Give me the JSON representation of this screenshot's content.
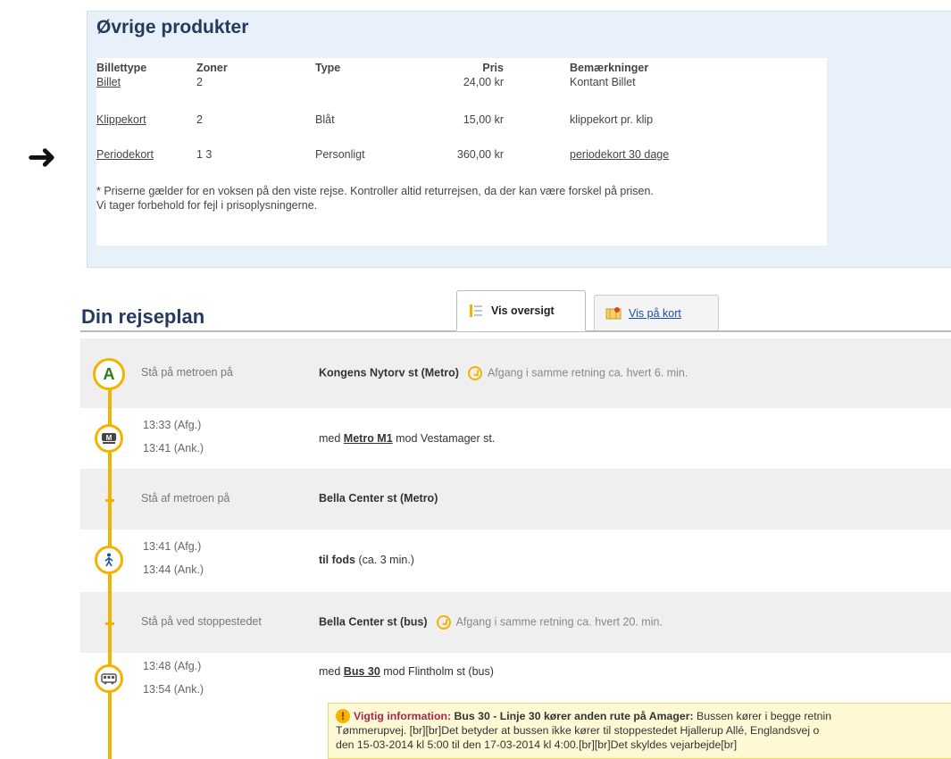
{
  "products": {
    "title": "Øvrige produkter",
    "headers": [
      "Billettype",
      "Zoner",
      "Type",
      "Pris",
      "Bemærkninger"
    ],
    "rows": [
      {
        "billettype": "Billet",
        "zoner": "2",
        "type": "",
        "pris": "24,00 kr",
        "bemaerkninger": "Kontant Billet",
        "link_note": false
      },
      {
        "billettype": "Klippekort",
        "zoner": "2",
        "type": "Blåt",
        "pris": "15,00 kr",
        "bemaerkninger": "klippekort pr. klip",
        "link_note": false
      },
      {
        "billettype": "Periodekort",
        "zoner": "1 3",
        "type": "Personligt",
        "pris": "360,00 kr",
        "bemaerkninger": "periodekort 30 dage",
        "link_note": true
      }
    ],
    "note_line1": "* Priserne gælder for en voksen på den viste rejse. Kontroller altid returrejsen, da der kan være forskel på prisen.",
    "note_line2": "Vi tager forbehold for fejl i prisoplysningerne."
  },
  "rejseplan": {
    "title": "Din rejseplan",
    "tab_overview": "Vis oversigt",
    "tab_map": "Vis på kort",
    "node_start": "A",
    "steps": {
      "s1_label": "Stå på metroen på",
      "s1_station": "Kongens Nytorv st (Metro)",
      "s1_hint": "Afgang i samme retning ca. hvert 6. min.",
      "s2_dep": "13:33 (Afg.)",
      "s2_arr": "13:41 (Ank.)",
      "s2_pre": "med ",
      "s2_link": "Metro M1",
      "s2_post": " mod Vestamager st.",
      "s3_label": "Stå af metroen på",
      "s3_station": "Bella Center st (Metro)",
      "s4_dep": "13:41 (Afg.)",
      "s4_arr": "13:44 (Ank.)",
      "s4_bold": "til fods",
      "s4_rest": " (ca. 3 min.)",
      "s5_label": "Stå på ved stoppestedet",
      "s5_station": "Bella Center st (bus)",
      "s5_hint": "Afgang i samme retning ca. hvert 20. min.",
      "s6_dep": "13:48 (Afg.)",
      "s6_arr": "13:54 (Ank.)",
      "s6_pre": "med ",
      "s6_link": "Bus 30",
      "s6_post": " mod Flintholm st (bus)"
    },
    "warning": {
      "title": "Vigtig information:",
      "headline": " Bus 30 - Linje 30 kører anden rute på Amager:",
      "body1": " Bussen kører i begge retnin",
      "body2": "Tømmerupvej. [br][br]Det betyder at bussen ikke kører til stoppestedet Hjallerup Allé, Englandsvej o",
      "body3": "den 15-03-2014 kl 5:00 til den 17-03-2014 kl 4:00.[br][br]Det skyldes vejarbejde[br]"
    }
  },
  "colors": {
    "accent": "#f2b400",
    "link": "#1a4fa0",
    "panel": "#e8f0f9",
    "title": "#243a5e"
  }
}
